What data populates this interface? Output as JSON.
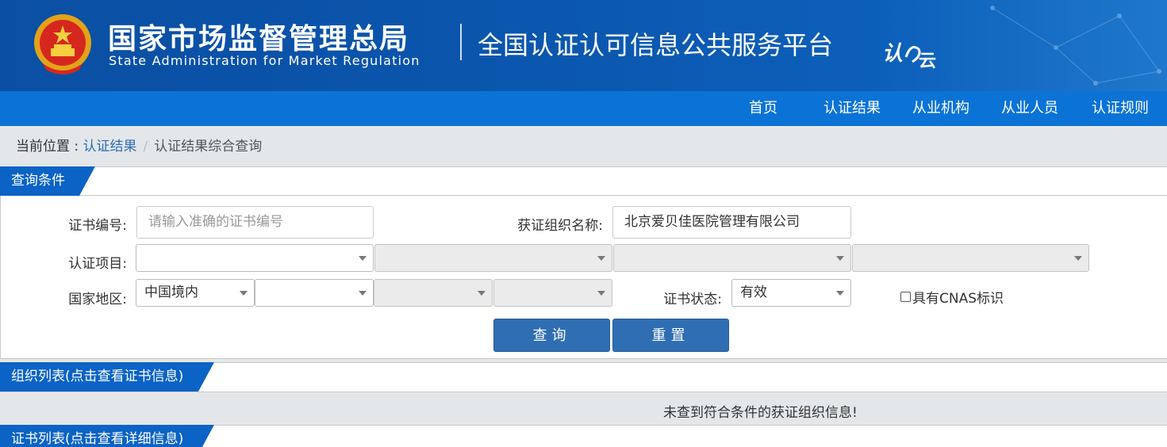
{
  "header": {
    "org_name_cn": "国家市场监督管理总局",
    "org_name_en": "State Administration  for  Market Regulation",
    "platform_title": "全国认证认可信息公共服务平台",
    "platform_logo_text": "认证云",
    "emblem_icon": "national-emblem-icon",
    "colors": {
      "banner": "#0b56ae",
      "nav": "#0b73d6",
      "tab": "#0b63c5",
      "button": "#2f6eb3"
    }
  },
  "nav": {
    "items": [
      {
        "label": "首页"
      },
      {
        "label": "认证结果"
      },
      {
        "label": "从业机构"
      },
      {
        "label": "从业人员"
      },
      {
        "label": "认证规则"
      }
    ]
  },
  "breadcrumb": {
    "prefix": "当前位置 : ",
    "link": "认证结果",
    "separator": "/",
    "current": "认证结果综合查询"
  },
  "query_panel": {
    "title": "查询条件",
    "cert_no_label": "证书编号:",
    "cert_no_placeholder": "请输入准确的证书编号",
    "org_name_label": "获证组织名称:",
    "org_name_value": "北京爱贝佳医院管理有限公司",
    "project_label": "认证项目:",
    "project_selects": [
      "",
      "",
      "",
      ""
    ],
    "region_label": "国家地区:",
    "region_selects": [
      "中国境内",
      "",
      "",
      ""
    ],
    "status_label": "证书状态:",
    "status_value": "有效",
    "cnas_label": "具有CNAS标识",
    "cnas_checked": false,
    "search_button": "查询",
    "reset_button": "重置"
  },
  "org_list": {
    "title": "组织列表(点击查看证书信息)",
    "empty_message": "未查到符合条件的获证组织信息!"
  },
  "cert_list": {
    "title": "证书列表(点击查看详细信息)"
  }
}
